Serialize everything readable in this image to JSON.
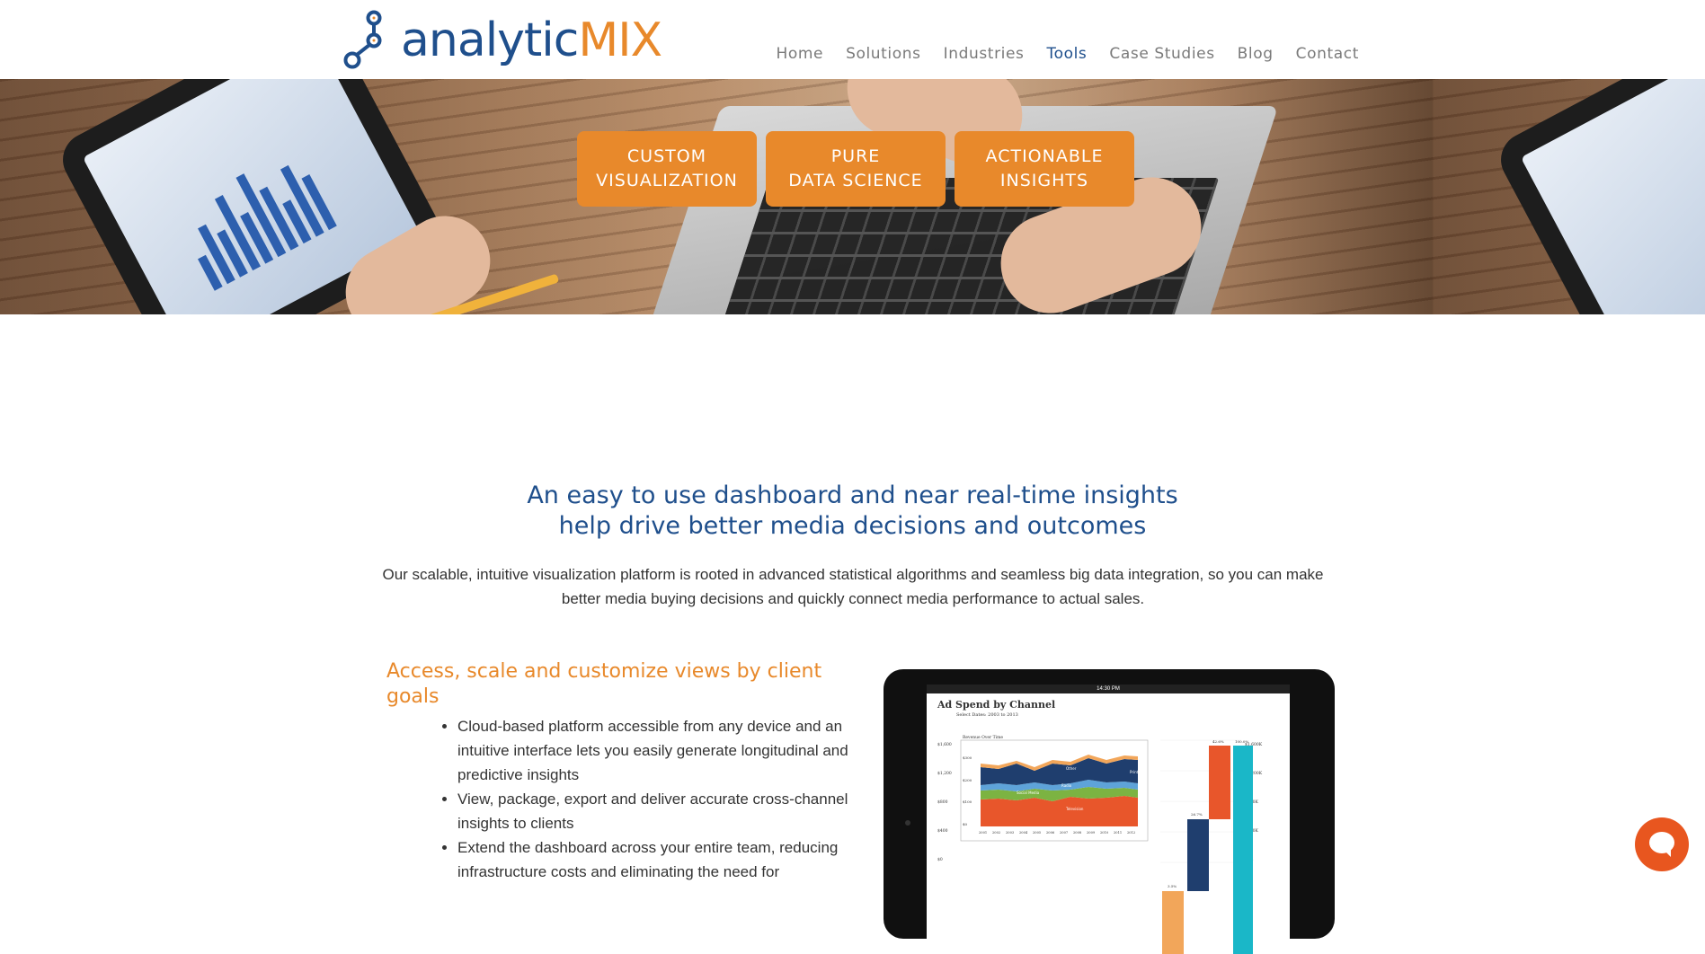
{
  "brand": {
    "name_part1": "analytic",
    "name_part2": "MIX",
    "primary_color": "#1f4f8c",
    "accent_color": "#e8892b"
  },
  "nav": {
    "items": [
      {
        "label": "Home"
      },
      {
        "label": "Solutions"
      },
      {
        "label": "Industries"
      },
      {
        "label": "Tools",
        "active": true
      },
      {
        "label": "Case Studies"
      },
      {
        "label": "Blog"
      },
      {
        "label": "Contact"
      }
    ]
  },
  "hero": {
    "boxes": [
      {
        "line1": "CUSTOM",
        "line2": "VISUALIZATION"
      },
      {
        "line1": "PURE",
        "line2": "DATA SCIENCE"
      },
      {
        "line1": "ACTIONABLE",
        "line2": "INSIGHTS"
      }
    ]
  },
  "main": {
    "headline_line1": "An easy to use dashboard and near real-time insights",
    "headline_line2": "help drive better media decisions and outcomes",
    "intro": "Our scalable, intuitive visualization platform is rooted in advanced statistical algorithms and seamless big data integration, so you can make better media buying decisions and quickly connect media performance to actual sales.",
    "feature_title": "Access, scale and customize views by client goals",
    "bullets": [
      "Cloud-based platform accessible from any device and an intuitive interface lets you easily generate longitudinal and predictive insights",
      "View, package, export and deliver accurate cross-channel insights to clients",
      "Extend the dashboard across your entire team, reducing infrastructure costs and eliminating the need for"
    ]
  },
  "device_screen": {
    "status_time": "14:30 PM",
    "title": "Ad Spend by Channel",
    "select_label": "Select Dates:",
    "select_value": "2003 to 2013",
    "area_chart_title": "Revenue Over Time",
    "area_labels": [
      "Other",
      "Radio",
      "Social Media",
      "Television",
      "Print"
    ],
    "x_years": [
      "2001",
      "2002",
      "2003",
      "2004",
      "2005",
      "2006",
      "2007",
      "2008",
      "2009",
      "2010",
      "2011",
      "2012"
    ],
    "left_ticks": [
      "$1,600",
      "$1,200",
      "$800",
      "$400",
      "$0"
    ],
    "right_ticks": [
      "$1,600K",
      "$1,200K",
      "$800K",
      "$400K",
      "$0K"
    ],
    "inner_ticks": [
      "$300",
      "$200",
      "$100",
      "$0"
    ],
    "waterfall_labels": [
      "3.5%",
      "26.7%",
      "42.6%",
      "100.0%"
    ],
    "colors": {
      "orange": "#e8562b",
      "navy": "#1f3e6e",
      "teal": "#1ab7c8",
      "green": "#7cb342",
      "peach": "#f2a65a"
    }
  },
  "chat": {
    "icon": "chat-bubble-icon",
    "color": "#e8561f"
  }
}
